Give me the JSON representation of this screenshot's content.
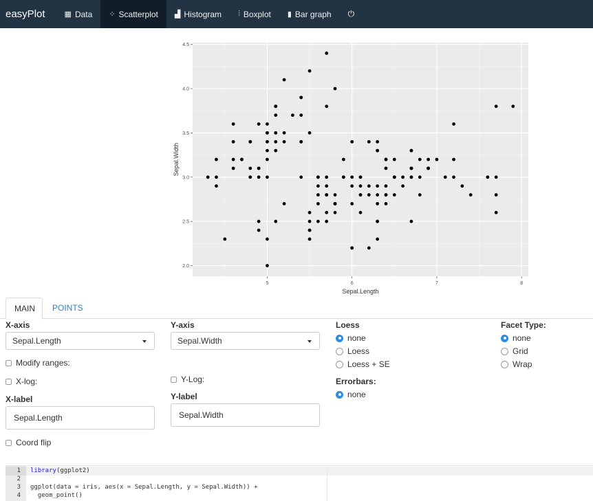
{
  "navbar": {
    "brand": "easyPlot",
    "items": [
      {
        "label": "Data",
        "icon": "table-icon",
        "glyph": "▦"
      },
      {
        "label": "Scatterplot",
        "icon": "scatter-spinner-icon",
        "glyph": "⁘"
      },
      {
        "label": "Histogram",
        "icon": "histogram-icon",
        "glyph": "▟"
      },
      {
        "label": "Boxplot",
        "icon": "sliders-icon",
        "glyph": "⫶"
      },
      {
        "label": "Bar graph",
        "icon": "bar-chart-icon",
        "glyph": "▮"
      }
    ],
    "power_glyph": "⏻",
    "active_color": "#111d28",
    "bg_color": "#223344"
  },
  "chart_data": {
    "type": "scatter",
    "xlabel": "Sepal.Length",
    "ylabel": "Sepal.Width",
    "xlim": [
      4.3,
      7.9
    ],
    "ylim": [
      2.0,
      4.4
    ],
    "x_ticks": [
      "5",
      "6",
      "7",
      "8"
    ],
    "y_ticks": [
      "2.0",
      "2.5",
      "3.0",
      "3.5",
      "4.0",
      "4.5"
    ],
    "grid": true,
    "panel_color": "#ebebeb",
    "point_color": "#000000",
    "points": [
      [
        5.1,
        3.5
      ],
      [
        4.9,
        3.0
      ],
      [
        4.7,
        3.2
      ],
      [
        4.6,
        3.1
      ],
      [
        5.0,
        3.6
      ],
      [
        5.4,
        3.9
      ],
      [
        4.6,
        3.4
      ],
      [
        5.0,
        3.4
      ],
      [
        4.4,
        2.9
      ],
      [
        4.9,
        3.1
      ],
      [
        5.4,
        3.7
      ],
      [
        4.8,
        3.4
      ],
      [
        4.8,
        3.0
      ],
      [
        4.3,
        3.0
      ],
      [
        5.8,
        4.0
      ],
      [
        5.7,
        4.4
      ],
      [
        5.4,
        3.9
      ],
      [
        5.1,
        3.5
      ],
      [
        5.7,
        3.8
      ],
      [
        5.1,
        3.8
      ],
      [
        5.4,
        3.4
      ],
      [
        5.1,
        3.7
      ],
      [
        4.6,
        3.6
      ],
      [
        5.1,
        3.3
      ],
      [
        4.8,
        3.4
      ],
      [
        5.0,
        3.0
      ],
      [
        5.0,
        3.4
      ],
      [
        5.2,
        3.5
      ],
      [
        5.2,
        3.4
      ],
      [
        4.7,
        3.2
      ],
      [
        4.8,
        3.1
      ],
      [
        5.4,
        3.4
      ],
      [
        5.2,
        4.1
      ],
      [
        5.5,
        4.2
      ],
      [
        4.9,
        3.1
      ],
      [
        5.0,
        3.2
      ],
      [
        5.5,
        3.5
      ],
      [
        4.9,
        3.6
      ],
      [
        4.4,
        3.0
      ],
      [
        5.1,
        3.4
      ],
      [
        5.0,
        3.5
      ],
      [
        4.5,
        2.3
      ],
      [
        4.4,
        3.2
      ],
      [
        5.0,
        3.5
      ],
      [
        5.1,
        3.8
      ],
      [
        4.8,
        3.0
      ],
      [
        5.1,
        3.8
      ],
      [
        4.6,
        3.2
      ],
      [
        5.3,
        3.7
      ],
      [
        5.0,
        3.3
      ],
      [
        7.0,
        3.2
      ],
      [
        6.4,
        3.2
      ],
      [
        6.9,
        3.1
      ],
      [
        5.5,
        2.3
      ],
      [
        6.5,
        2.8
      ],
      [
        5.7,
        2.8
      ],
      [
        6.3,
        3.3
      ],
      [
        4.9,
        2.4
      ],
      [
        6.6,
        2.9
      ],
      [
        5.2,
        2.7
      ],
      [
        5.0,
        2.0
      ],
      [
        5.9,
        3.0
      ],
      [
        6.0,
        2.2
      ],
      [
        6.1,
        2.9
      ],
      [
        5.6,
        2.9
      ],
      [
        6.7,
        3.1
      ],
      [
        5.6,
        3.0
      ],
      [
        5.8,
        2.7
      ],
      [
        6.2,
        2.2
      ],
      [
        5.6,
        2.5
      ],
      [
        5.9,
        3.2
      ],
      [
        6.1,
        2.8
      ],
      [
        6.3,
        2.5
      ],
      [
        6.1,
        2.8
      ],
      [
        6.4,
        2.9
      ],
      [
        6.6,
        3.0
      ],
      [
        6.8,
        2.8
      ],
      [
        6.7,
        3.0
      ],
      [
        6.0,
        2.9
      ],
      [
        5.7,
        2.6
      ],
      [
        5.5,
        2.4
      ],
      [
        5.5,
        2.4
      ],
      [
        5.8,
        2.7
      ],
      [
        6.0,
        2.7
      ],
      [
        5.4,
        3.0
      ],
      [
        6.0,
        3.4
      ],
      [
        6.7,
        3.1
      ],
      [
        6.3,
        2.3
      ],
      [
        5.6,
        3.0
      ],
      [
        5.5,
        2.5
      ],
      [
        5.5,
        2.6
      ],
      [
        6.1,
        3.0
      ],
      [
        5.8,
        2.6
      ],
      [
        5.0,
        2.3
      ],
      [
        5.6,
        2.7
      ],
      [
        5.7,
        3.0
      ],
      [
        5.7,
        2.9
      ],
      [
        6.2,
        2.9
      ],
      [
        5.1,
        2.5
      ],
      [
        5.7,
        2.8
      ],
      [
        6.3,
        3.3
      ],
      [
        5.8,
        2.7
      ],
      [
        7.1,
        3.0
      ],
      [
        6.3,
        2.9
      ],
      [
        6.5,
        3.0
      ],
      [
        7.6,
        3.0
      ],
      [
        4.9,
        2.5
      ],
      [
        7.3,
        2.9
      ],
      [
        6.7,
        2.5
      ],
      [
        7.2,
        3.6
      ],
      [
        6.5,
        3.2
      ],
      [
        6.4,
        2.7
      ],
      [
        6.8,
        3.0
      ],
      [
        5.7,
        2.5
      ],
      [
        5.8,
        2.8
      ],
      [
        6.4,
        3.2
      ],
      [
        6.5,
        3.0
      ],
      [
        7.7,
        3.8
      ],
      [
        7.7,
        2.6
      ],
      [
        6.0,
        2.2
      ],
      [
        6.9,
        3.2
      ],
      [
        5.6,
        2.8
      ],
      [
        7.7,
        2.8
      ],
      [
        6.3,
        2.7
      ],
      [
        6.7,
        3.3
      ],
      [
        7.2,
        3.2
      ],
      [
        6.2,
        2.8
      ],
      [
        6.1,
        3.0
      ],
      [
        6.4,
        2.8
      ],
      [
        7.2,
        3.0
      ],
      [
        7.4,
        2.8
      ],
      [
        7.9,
        3.8
      ],
      [
        6.4,
        2.8
      ],
      [
        6.3,
        2.8
      ],
      [
        6.1,
        2.6
      ],
      [
        7.7,
        3.0
      ],
      [
        6.3,
        3.4
      ],
      [
        6.4,
        3.1
      ],
      [
        6.0,
        3.0
      ],
      [
        6.9,
        3.1
      ],
      [
        6.7,
        3.1
      ],
      [
        6.9,
        3.1
      ],
      [
        5.8,
        2.7
      ],
      [
        6.8,
        3.2
      ],
      [
        6.7,
        3.3
      ],
      [
        6.7,
        3.0
      ],
      [
        6.3,
        2.5
      ],
      [
        6.5,
        3.0
      ],
      [
        6.2,
        3.4
      ],
      [
        5.9,
        3.0
      ]
    ]
  },
  "tabs": {
    "main": "MAIN",
    "points": "POINTS"
  },
  "form": {
    "x_axis_label": "X-axis",
    "x_axis_value": "Sepal.Length",
    "y_axis_label": "Y-axis",
    "y_axis_value": "Sepal.Width",
    "modify_ranges": "Modify ranges:",
    "x_log": "X-log:",
    "y_log": "Y-Log:",
    "x_label_title": "X-label",
    "x_label_value": "Sepal.Length",
    "y_label_title": "Y-label",
    "y_label_value": "Sepal.Width",
    "coord_flip": "Coord flip",
    "loess_title": "Loess",
    "loess_options": [
      "none",
      "Loess",
      "Loess + SE"
    ],
    "loess_selected": "none",
    "errorbars_title": "Errorbars:",
    "errorbars_option": "none",
    "facet_title": "Facet Type:",
    "facet_options": [
      "none",
      "Grid",
      "Wrap"
    ],
    "facet_selected": "none",
    "accent_color": "#2f8ce0"
  },
  "editor": {
    "line_numbers": [
      "1",
      "2",
      "3",
      "4"
    ],
    "lines": [
      "",
      "",
      "ggplot(data = iris, aes(x = Sepal.Length, y = Sepal.Width)) +",
      "  geom_point()"
    ],
    "line1_keyword": "library",
    "line1_rest": "(ggplot2)"
  }
}
